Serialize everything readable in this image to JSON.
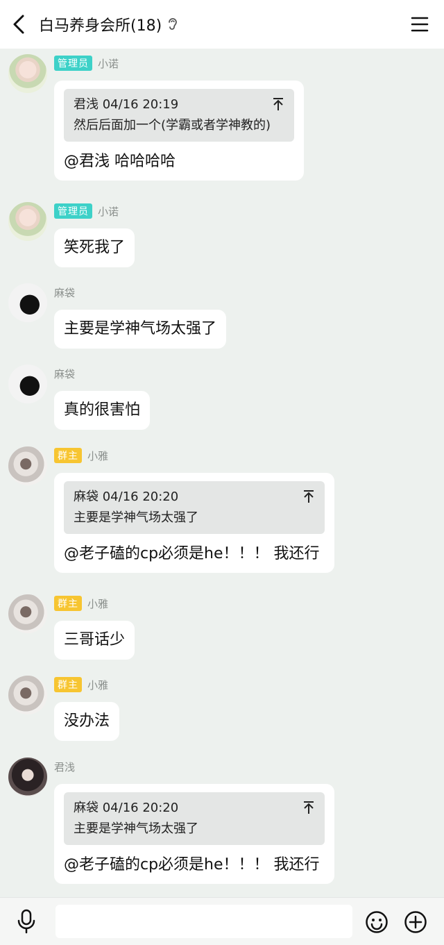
{
  "header": {
    "title": "白马养身会所(18)",
    "back_icon": "chevron-left-icon",
    "ear_icon": "ear-icon",
    "menu_icon": "hamburger-menu-icon"
  },
  "messages": [
    {
      "badge": "管理员",
      "nick": "小诺",
      "quote": {
        "head": "君浅 04/16 20:19",
        "text": "然后后面加一个(学霸或者学神教的)"
      },
      "text": "@君浅 哈哈哈哈"
    },
    {
      "badge": "管理员",
      "nick": "小诺",
      "text": "笑死我了"
    },
    {
      "nick": "麻袋",
      "text": "主要是学神气场太强了"
    },
    {
      "nick": "麻袋",
      "text": "真的很害怕"
    },
    {
      "badge": "群主",
      "nick": "小雅",
      "quote": {
        "head": "麻袋 04/16 20:20",
        "text": "主要是学神气场太强了"
      },
      "text": "@老子磕的cp必须是he！！！ 我还行"
    },
    {
      "badge": "群主",
      "nick": "小雅",
      "text": "三哥话少"
    },
    {
      "badge": "群主",
      "nick": "小雅",
      "text": "没办法"
    },
    {
      "nick": "君浅",
      "quote": {
        "head": "麻袋 04/16 20:20",
        "text": "主要是学神气场太强了"
      },
      "text": "@老子磕的cp必须是he！！！ 我还行"
    }
  ],
  "input_bar": {
    "placeholder": "",
    "mic_icon": "microphone-icon",
    "emoji_icon": "emoji-icon",
    "plus_icon": "plus-icon"
  },
  "colors": {
    "background": "#edf1ee",
    "admin_badge": "#3dd1c8",
    "owner_badge": "#f7c531",
    "bubble": "#ffffff",
    "quote": "#e4e6e5"
  }
}
